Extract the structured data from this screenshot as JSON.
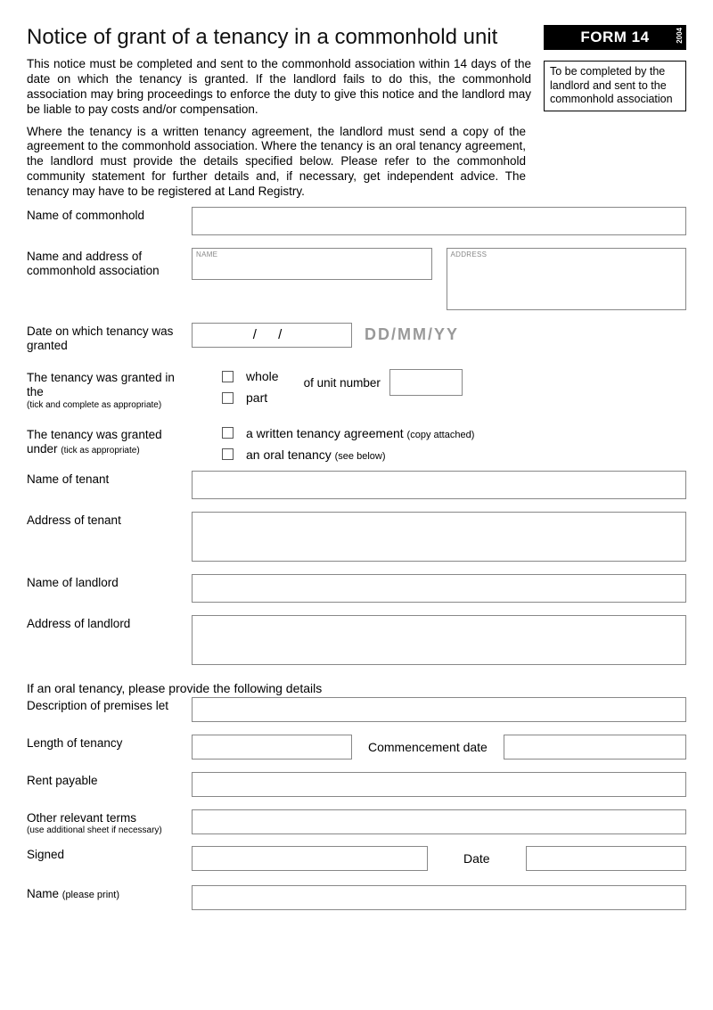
{
  "header": {
    "title": "Notice of grant of a tenancy in a commonhold unit",
    "form_code": "FORM 14",
    "year": "2004",
    "side_note": "To be completed by the landlord and sent to the commonhold association"
  },
  "intro": {
    "p1": "This notice must be completed and sent to the commonhold association within 14 days of the date on which the tenancy is granted. If the landlord fails to do this, the commonhold association may bring proceedings to enforce the duty to give this notice and the landlord may be liable to pay costs and/or compensation.",
    "p2": "Where the tenancy is a written tenancy agreement, the landlord must send a copy of the agreement to the commonhold association. Where the tenancy is an oral tenancy agreement, the landlord must provide the details specified below. Please refer to the commonhold community statement for further details and, if necessary, get independent advice. The tenancy may have to be registered at Land Registry."
  },
  "fields": {
    "name_commonhold_label": "Name of commonhold",
    "assoc_label": "Name and address of commonhold association",
    "assoc_name_ph": "NAME",
    "assoc_addr_ph": "ADDRESS",
    "date_granted_label": "Date on which tenancy was granted",
    "date_slashes": "/      /",
    "date_hint": "DD/MM/YY",
    "granted_in_label": "The tenancy was granted in the",
    "granted_in_hint": "(tick and complete as appropriate)",
    "opt_whole": "whole",
    "opt_part": "part",
    "unit_label": "of unit number",
    "granted_under_label": "The tenancy was granted under",
    "granted_under_hint": "(tick as appropriate)",
    "opt_written": "a written tenancy agreement",
    "opt_written_hint": "(copy attached)",
    "opt_oral": "an oral tenancy",
    "opt_oral_hint": "(see below)",
    "tenant_name_label": "Name of tenant",
    "tenant_addr_label": "Address of tenant",
    "landlord_name_label": "Name of landlord",
    "landlord_addr_label": "Address of landlord",
    "oral_heading": "If an oral tenancy, please provide the following details",
    "premises_label": "Description of premises let",
    "length_label": "Length of tenancy",
    "commence_label": "Commencement date",
    "rent_label": "Rent payable",
    "other_terms_label": "Other relevant terms",
    "other_terms_hint": "(use additional sheet if necessary)",
    "signed_label": "Signed",
    "date_label": "Date",
    "name_print_label": "Name",
    "name_print_hint": "(please print)"
  }
}
